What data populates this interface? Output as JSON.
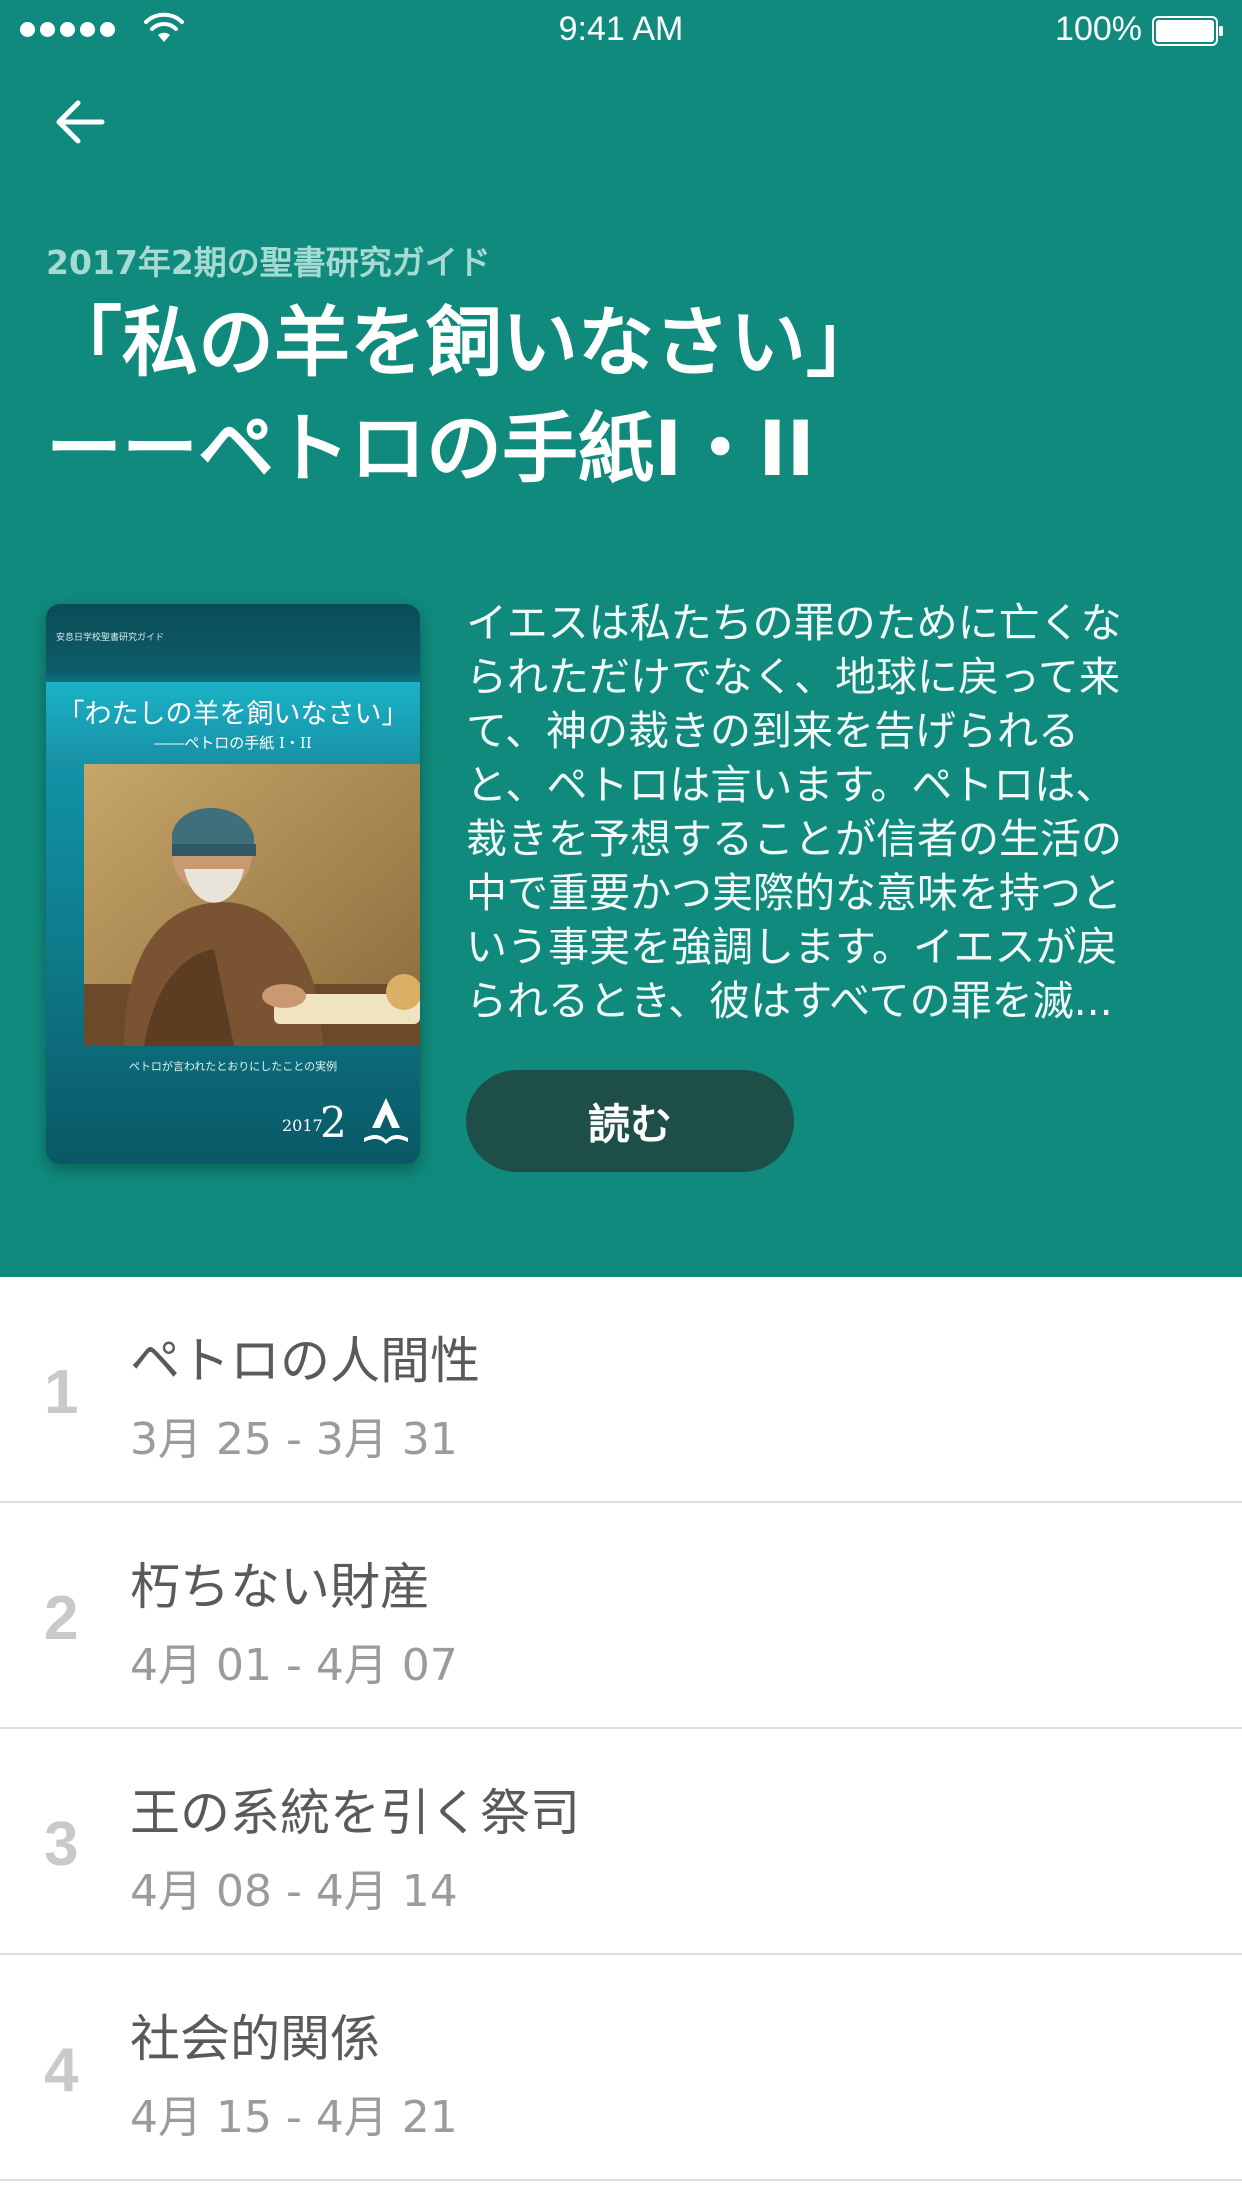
{
  "status_bar": {
    "time": "9:41 AM",
    "battery": "100%"
  },
  "header": {
    "subtitle": "2017年2期の聖書研究ガイド",
    "title_lines": [
      "「私の羊を飼いなさい」",
      "ーーペトロの手紙I・II"
    ],
    "background_color": "#108a7c"
  },
  "cover": {
    "top_label": "安息日学校聖書研究ガイド",
    "title": "「わたしの羊を飼いなさい」",
    "subtitle": "――ペトロの手紙 I・II",
    "caption": "ペトロが言われたとおりにしたことの実例",
    "year": "2017",
    "quarter": "2"
  },
  "description": {
    "lines": [
      "イエスは私たちの罪のために亡くな",
      "られただけでなく、地球に戻って来",
      "て、神の裁きの到来を告げられる",
      "と、ペトロは言います。ペトロは、",
      "裁きを予想することが信者の生活の",
      "中で重要かつ実際的な意味を持つと",
      "いう事実を強調します。イエスが戻",
      "られるとき、彼はすべての罪を滅..."
    ]
  },
  "read_button": {
    "label": "読む",
    "color": "#1e4e48"
  },
  "lessons": [
    {
      "number": "1",
      "title": "ペトロの人間性",
      "date": "3月 25 - 3月 31"
    },
    {
      "number": "2",
      "title": "朽ちない財産",
      "date": "4月 01 - 4月 07"
    },
    {
      "number": "3",
      "title": "王の系統を引く祭司",
      "date": "4月 08 - 4月 14"
    },
    {
      "number": "4",
      "title": "社会的関係",
      "date": "4月 15 - 4月 21"
    }
  ],
  "icons": {
    "back": "arrow-left-icon",
    "signal": "signal-dots-icon",
    "wifi": "wifi-icon",
    "battery": "battery-icon"
  }
}
